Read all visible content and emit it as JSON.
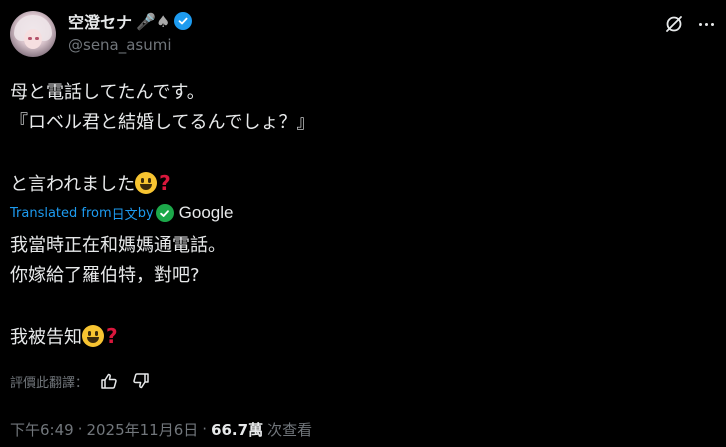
{
  "author": {
    "display_name": "空澄セナ",
    "name_emojis": "🎤♠",
    "handle": "@sena_asumi"
  },
  "tweet": {
    "lines": [
      "母と電話してたんです。",
      "『ロベル君と結婚してるんでしょ？』",
      "",
      "と言われました"
    ]
  },
  "translation_label": {
    "prefix": "Translated from ",
    "language": "日文",
    "by": " by",
    "provider": "Google"
  },
  "translation": {
    "lines": [
      "我當時正在和媽媽通電話。",
      "你嫁給了羅伯特，對吧?",
      "",
      "我被告知"
    ]
  },
  "rating": {
    "label": "評價此翻譯："
  },
  "meta": {
    "time": "下午6:49",
    "date": "2025年11月6日",
    "views": "66.7萬",
    "views_label": "次查看",
    "dot": "·"
  },
  "icons": {
    "verified": "verified-badge-icon",
    "grok": "grok-icon",
    "more": "more-icon",
    "thumbs_up": "thumbs-up-icon",
    "thumbs_down": "thumbs-down-icon",
    "smile": "grinning-face-emoji",
    "question": "red-question-mark-emoji"
  },
  "colors": {
    "background": "#000000",
    "text": "#e7e9ea",
    "muted": "#71767b",
    "accent": "#1d9bf0"
  }
}
